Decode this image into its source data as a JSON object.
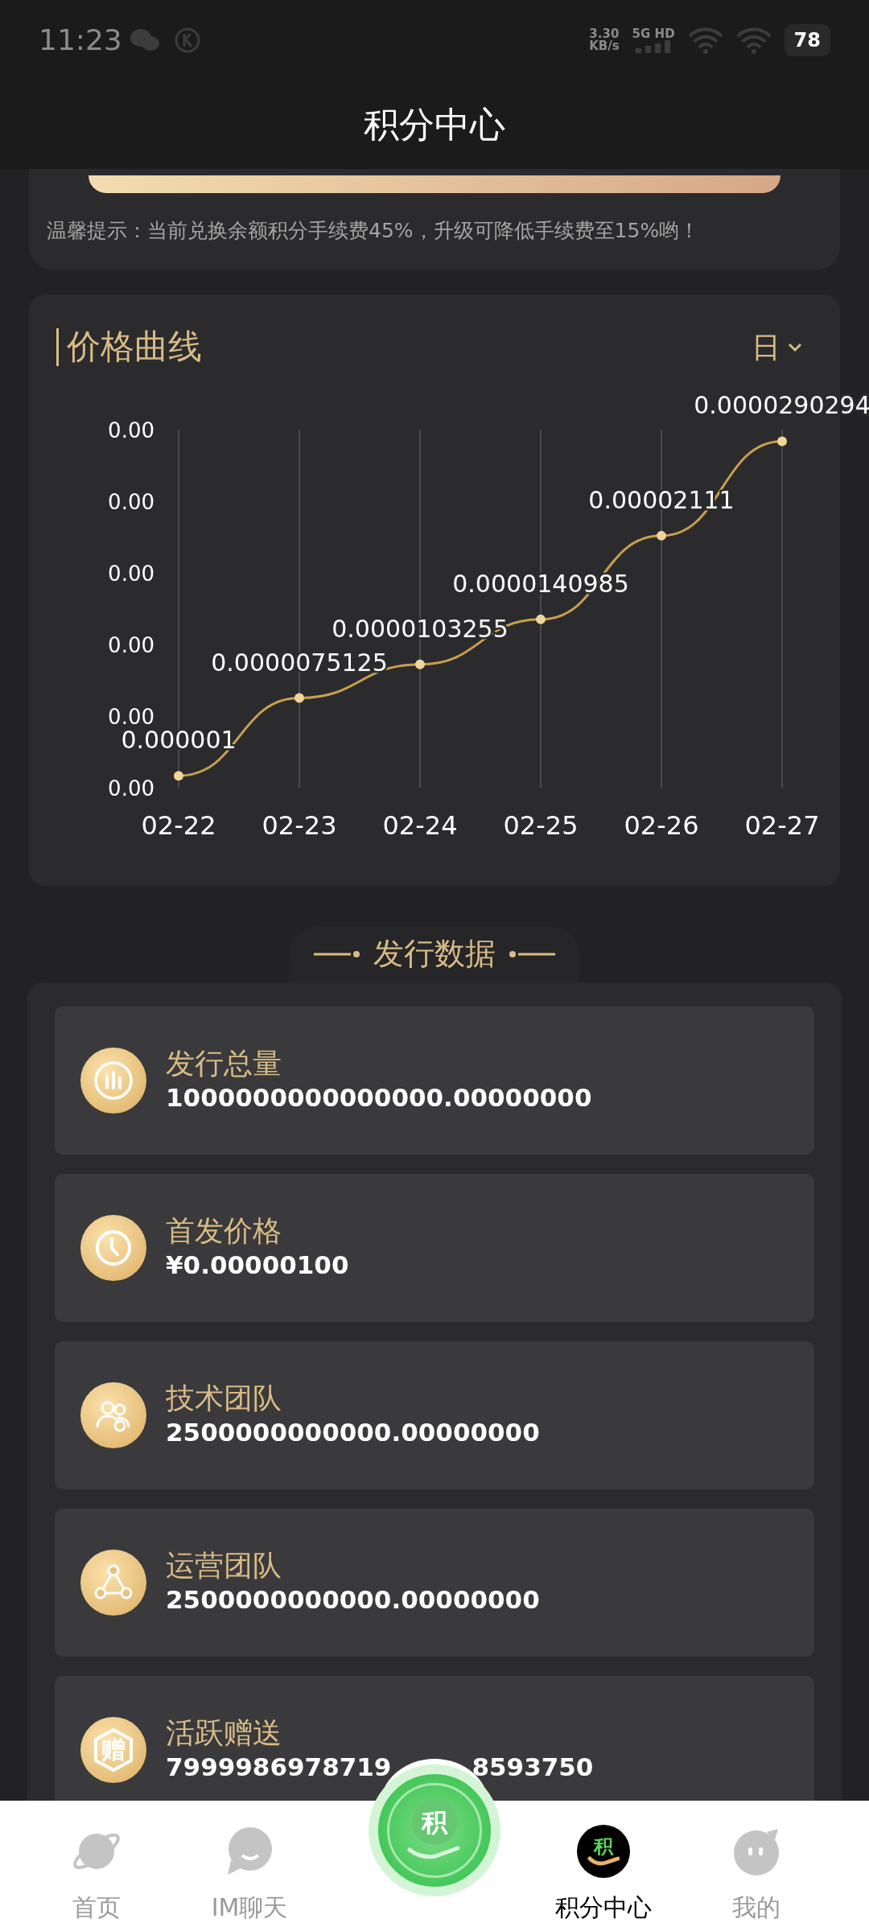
{
  "status_bar": {
    "time": "11:23",
    "speed": "3.30",
    "speed_unit": "KB/s",
    "network": "5G HD",
    "battery": "78"
  },
  "header": {
    "title": "积分中心"
  },
  "notice": {
    "text": "温馨提示：当前兑换余额积分手续费45%，升级可降低手续费至15%哟！"
  },
  "price_card": {
    "title": "价格曲线",
    "period": "日",
    "chart_data": {
      "type": "line",
      "grid": true,
      "categories": [
        "02-22",
        "02-23",
        "02-24",
        "02-25",
        "02-26",
        "02-27"
      ],
      "series": [
        {
          "color": "#c9a04f",
          "marker": true,
          "values": [
            1e-06,
            7.5125e-06,
            1.03255e-05,
            1.40985e-05,
            2.111e-05,
            2.90294e-05
          ]
        }
      ],
      "ylim": [
        0,
        3e-05
      ],
      "yticks": [
        {
          "value": 0,
          "label": "0.00"
        },
        {
          "value": 6e-06,
          "label": "0.00"
        },
        {
          "value": 1.2e-05,
          "label": "0.00"
        },
        {
          "value": 1.8e-05,
          "label": "0.00"
        },
        {
          "value": 2.4e-05,
          "label": "0.00"
        },
        {
          "value": 3e-05,
          "label": "0.00"
        }
      ],
      "value_labels": [
        "0.000001",
        "0.0000075125",
        "0.0000103255",
        "0.0000140985",
        "0.00002111",
        "0.0000290294"
      ]
    }
  },
  "issue_section": {
    "title": "发行数据",
    "items": [
      {
        "kind": "chart",
        "label": "发行总量",
        "value": "1000000000000000.00000000"
      },
      {
        "kind": "clock",
        "label": "首发价格",
        "value": "¥0.00000100"
      },
      {
        "kind": "team",
        "label": "技术团队",
        "value": "2500000000000.00000000"
      },
      {
        "kind": "network",
        "label": "运营团队",
        "value": "2500000000000.00000000"
      },
      {
        "kind": "gift",
        "label": "活跃赠送",
        "value": "7999986978719",
        "value_end": "8593750",
        "icon_text": "赠"
      }
    ]
  },
  "bottom_nav": {
    "center_button": {
      "icon_text": "积"
    },
    "tabs": [
      {
        "kind": "planet",
        "label": "首页",
        "selected": false
      },
      {
        "kind": "chat",
        "label": "IM聊天",
        "selected": false
      },
      {
        "kind": "points",
        "label": "积分中心",
        "selected": true,
        "icon_text": "积"
      },
      {
        "kind": "face",
        "label": "我的",
        "selected": false
      }
    ]
  }
}
